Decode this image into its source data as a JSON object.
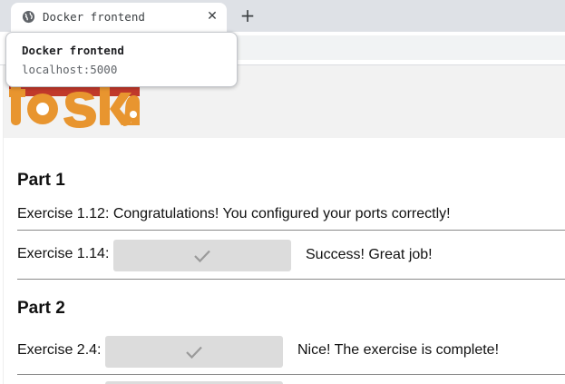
{
  "browser": {
    "tab_title": "Docker frontend",
    "close_glyph": "✕",
    "new_tab_glyph": "+",
    "tab_icon": "globe-icon"
  },
  "hovercard": {
    "title": "Docker frontend",
    "url": "localhost:5000"
  },
  "colors": {
    "logo_red": "#c0392b",
    "logo_orange": "#e8952f",
    "button_gray": "#dcdcdc",
    "check_gray": "#9a9a9a"
  },
  "content": {
    "part1_heading": "Part 1",
    "ex_1_12": "Exercise 1.12: Congratulations! You configured your ports correctly!",
    "ex_1_14_label": "Exercise 1.14:",
    "ex_1_14_result": "Success! Great job!",
    "part2_heading": "Part 2",
    "ex_2_4_label": "Exercise 2.4:",
    "ex_2_4_result": "Nice! The exercise is complete!",
    "check_icon": "checkmark-icon"
  }
}
